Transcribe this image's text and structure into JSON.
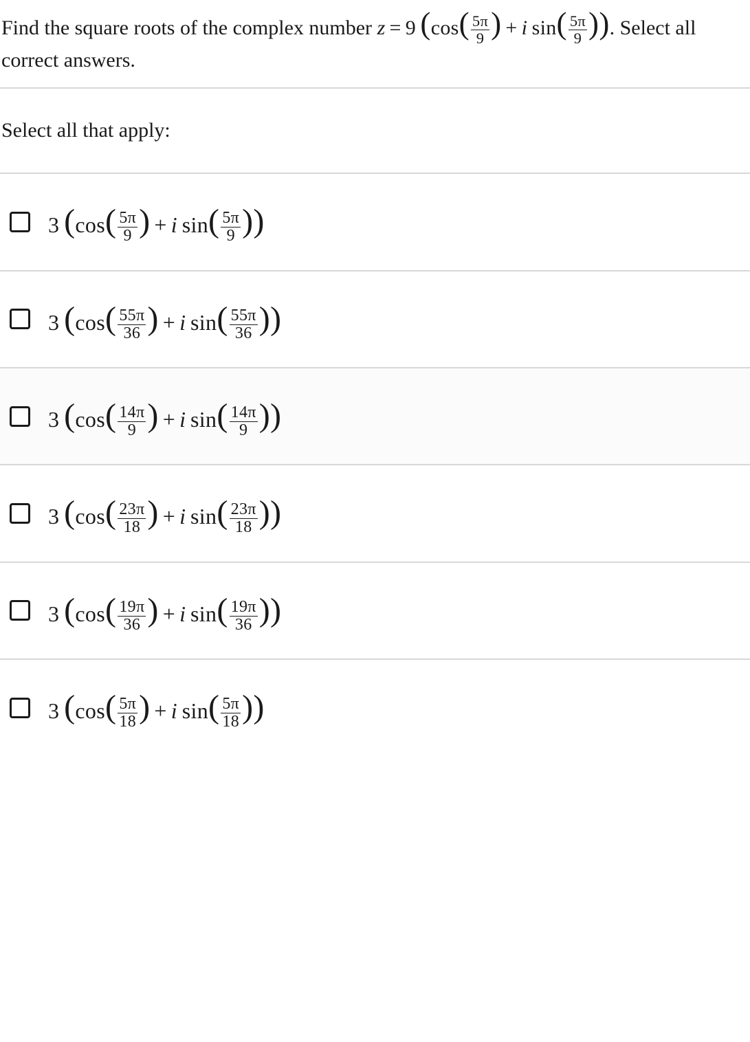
{
  "question": {
    "prefix": "Find the square roots of the complex number ",
    "zvar": "z",
    "eq": "=",
    "coef": "9",
    "cos": "cos",
    "sin": "sin",
    "iunit": "i",
    "frac_num": "5π",
    "frac_den": "9",
    "suffix": ". Select all correct answers."
  },
  "instructions": "Select all that apply:",
  "options": [
    {
      "coef": "3",
      "num": "5π",
      "den": "9",
      "highlight": false
    },
    {
      "coef": "3",
      "num": "55π",
      "den": "36",
      "highlight": false
    },
    {
      "coef": "3",
      "num": "14π",
      "den": "9",
      "highlight": true
    },
    {
      "coef": "3",
      "num": "23π",
      "den": "18",
      "highlight": false
    },
    {
      "coef": "3",
      "num": "19π",
      "den": "36",
      "highlight": false
    },
    {
      "coef": "3",
      "num": "5π",
      "den": "18",
      "highlight": false
    }
  ],
  "labels": {
    "cos": "cos",
    "sin": "sin",
    "i": "i",
    "plus": "+"
  }
}
